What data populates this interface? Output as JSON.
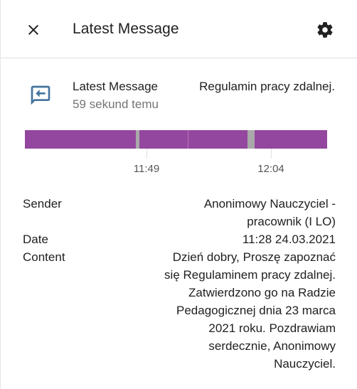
{
  "dialog": {
    "title": "Latest Message"
  },
  "entity": {
    "name": "Latest Message",
    "last_changed": "59 sekund temu",
    "state": "Regulamin pracy zdalnej."
  },
  "timeline": {
    "tick_labels": [
      "11:49",
      "12:04"
    ],
    "bar_color": "#94479f",
    "gap_color": "#a9a9a9"
  },
  "attributes": {
    "sender_label": "Sender",
    "sender_value": "Anonimowy Nauczyciel -\npracownik (I LO)",
    "date_label": "Date",
    "date_value": "11:28 24.03.2021",
    "content_label": "Content",
    "content_value": "Dzień dobry, Proszę zapoznać\nsię Regulaminem pracy zdalnej.\nZatwierdzono go na Radzie\nPedagogicznej dnia 23 marca\n2021 roku. Pozdrawiam\nserdecznie, Anonimowy\nNauczyciel."
  },
  "icons": {
    "close": "close-icon",
    "settings": "gear-icon",
    "entity": "message-reply-icon"
  },
  "colors": {
    "accent_icon": "#44739e",
    "timeline_state": "#94479f"
  }
}
